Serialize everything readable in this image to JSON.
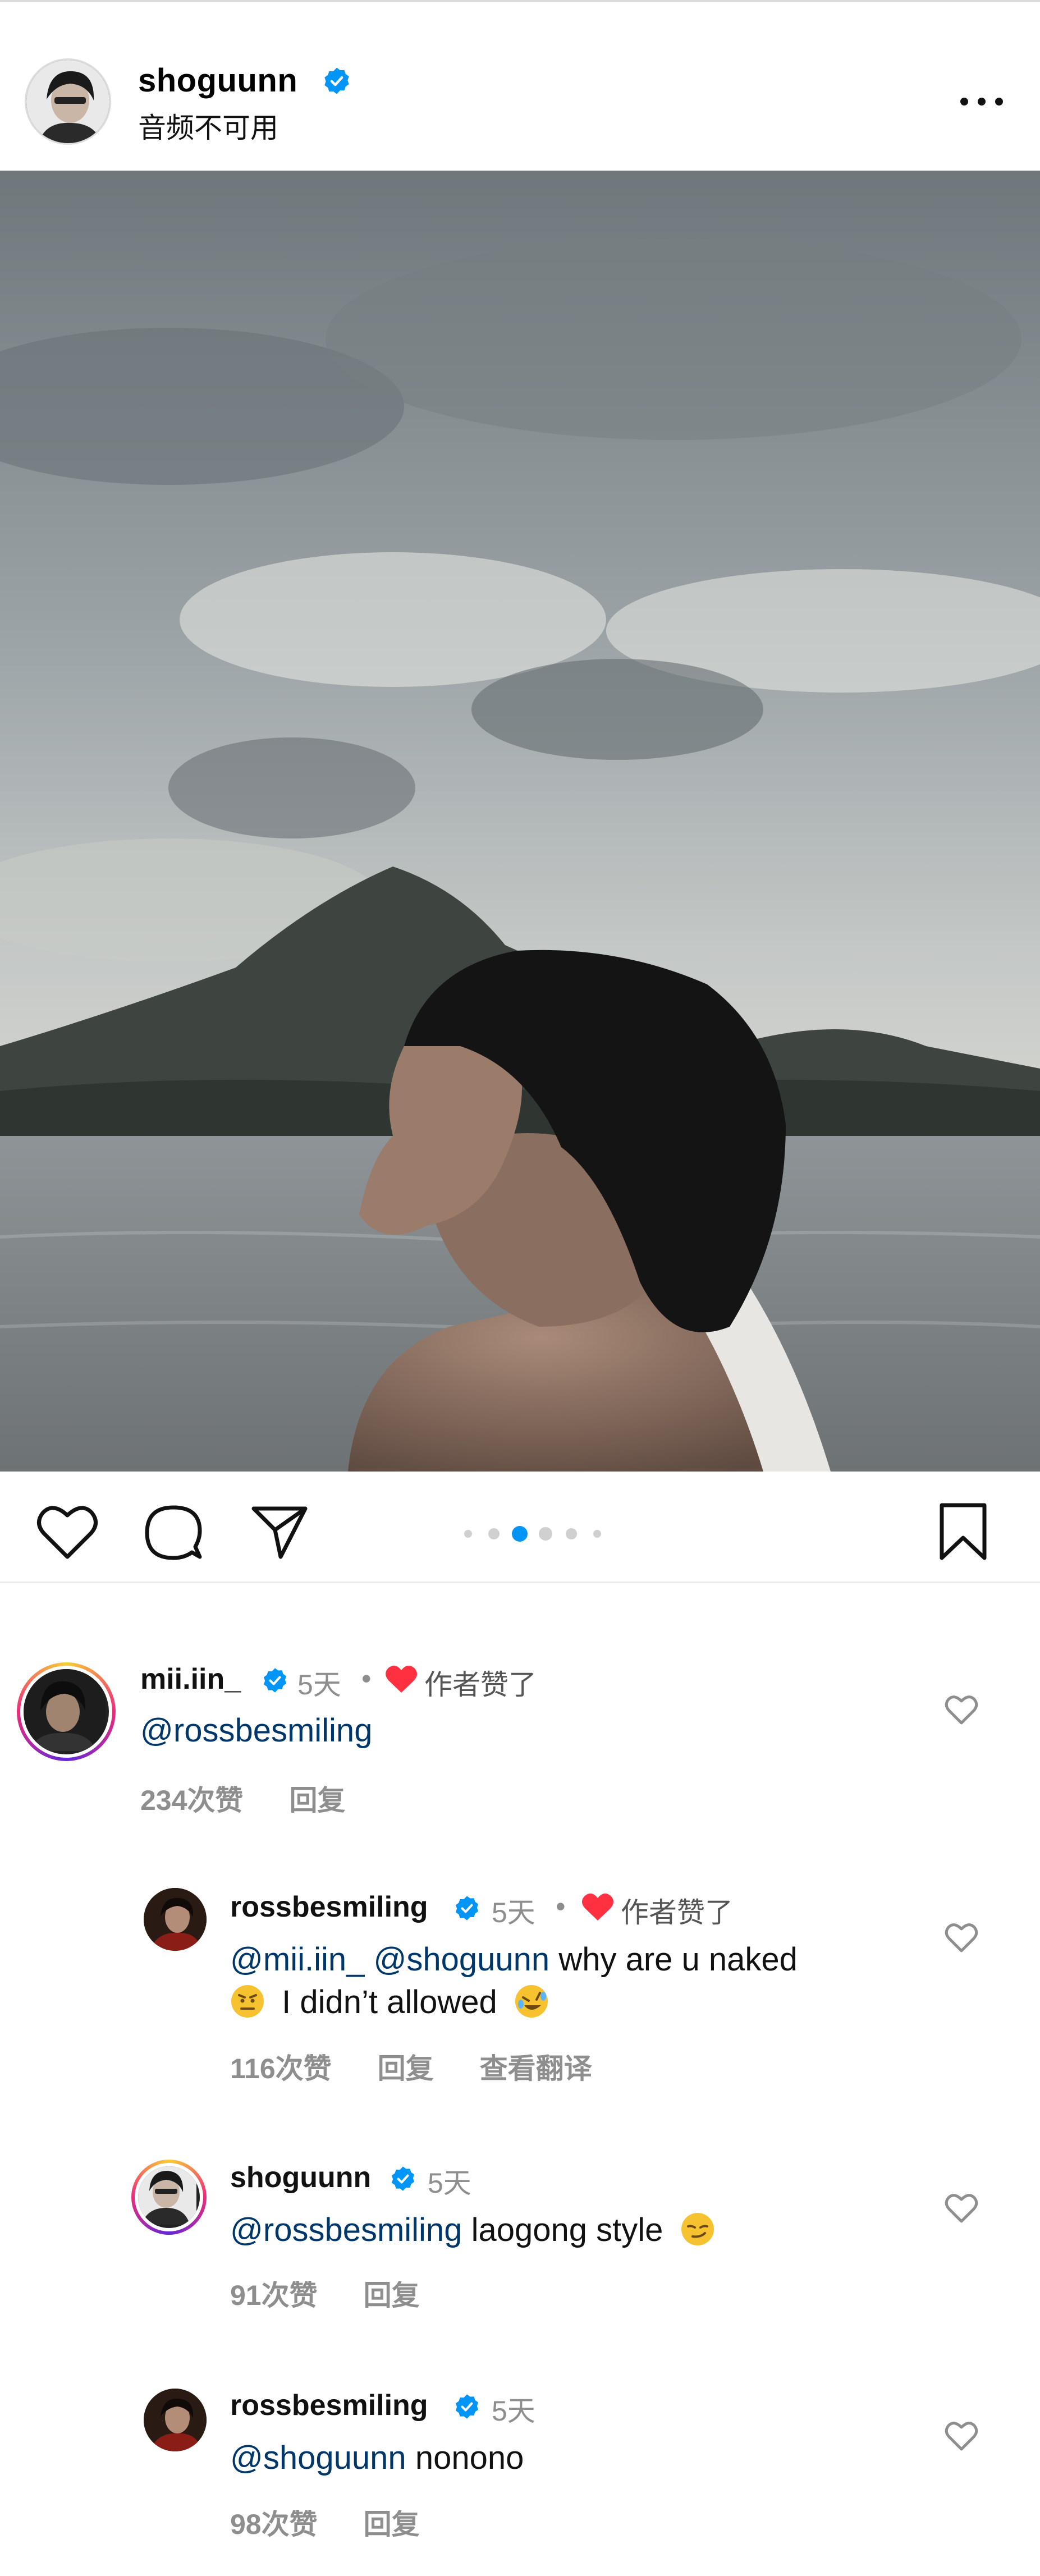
{
  "header": {
    "username": "shoguunn",
    "subtitle": "音频不可用"
  },
  "carousel": {
    "count": 6,
    "active_index": 2
  },
  "colors": {
    "accent": "#0095f6",
    "heart": "#ff3040",
    "mention": "#00376b",
    "meta": "#8e8e8e"
  },
  "icons": [
    "like-icon",
    "comment-icon",
    "share-icon",
    "bookmark-icon",
    "more-icon",
    "verified-icon"
  ],
  "comments": [
    {
      "username": "mii.iin_",
      "time": "5天",
      "sep": "•",
      "liked_by_author": "作者赞了",
      "mention": "@rossbesmiling",
      "likes": "234次赞",
      "reply": "回复"
    },
    {
      "username": "rossbesmiling",
      "time": "5天",
      "sep": "•",
      "liked_by_author": "作者赞了",
      "line1_mention1": "@mii.iin_",
      "line1_mention2": "@shoguunn",
      "line1_text": "why are u naked",
      "line2_text": "I didn’t allowed",
      "likes": "116次赞",
      "reply": "回复",
      "translate": "查看翻译"
    },
    {
      "username": "shoguunn",
      "time": "5天",
      "mention": "@rossbesmiling",
      "text": "laogong style",
      "likes": "91次赞",
      "reply": "回复"
    },
    {
      "username": "rossbesmiling",
      "time": "5天",
      "mention": "@shoguunn",
      "text": "nonono",
      "likes": "98次赞",
      "reply": "回复"
    }
  ]
}
